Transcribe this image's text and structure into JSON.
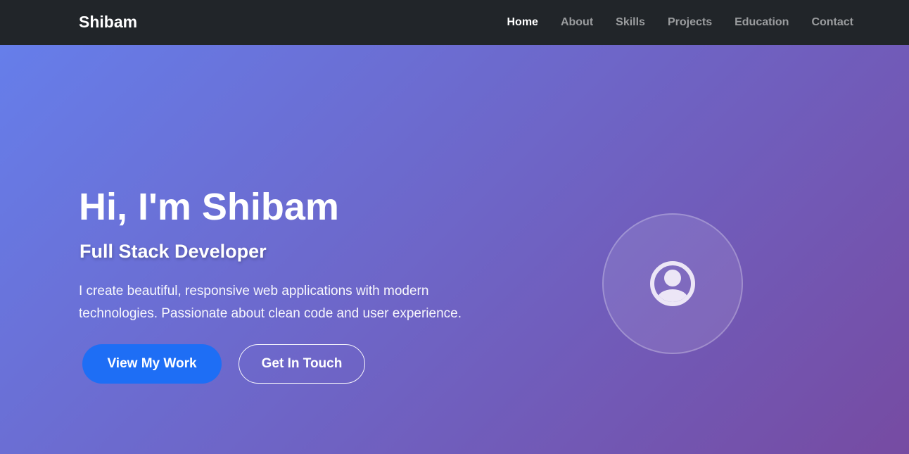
{
  "navbar": {
    "brand": "Shibam",
    "links": [
      {
        "label": "Home",
        "active": true
      },
      {
        "label": "About",
        "active": false
      },
      {
        "label": "Skills",
        "active": false
      },
      {
        "label": "Projects",
        "active": false
      },
      {
        "label": "Education",
        "active": false
      },
      {
        "label": "Contact",
        "active": false
      }
    ]
  },
  "hero": {
    "title": "Hi, I'm Shibam",
    "subtitle": "Full Stack Developer",
    "description": "I create beautiful, responsive web applications with modern technologies. Passionate about clean code and user experience.",
    "primary_button": "View My Work",
    "secondary_button": "Get In Touch",
    "avatar_icon": "user-circle-icon"
  },
  "colors": {
    "navbar_bg": "#212529",
    "gradient_start": "#667eea",
    "gradient_end": "#764ba2",
    "primary_button": "#1e6ef5"
  }
}
